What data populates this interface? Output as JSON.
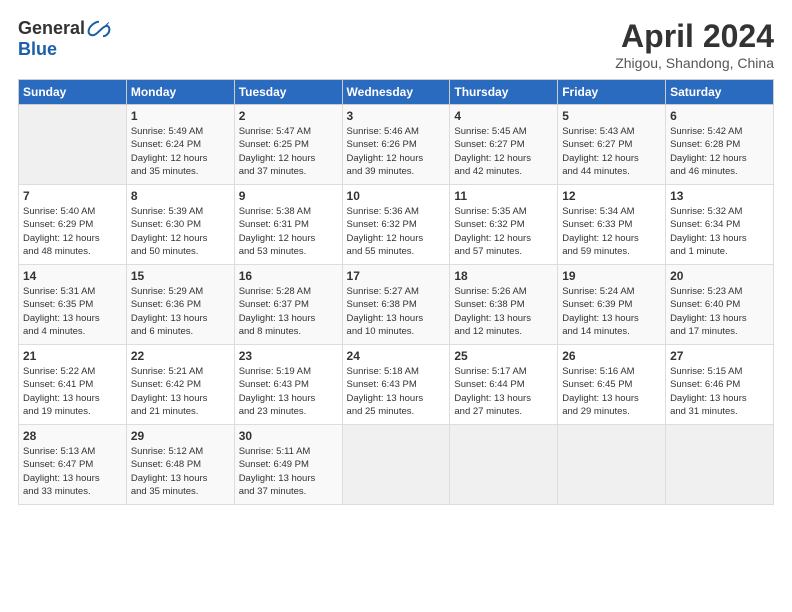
{
  "logo": {
    "general": "General",
    "blue": "Blue"
  },
  "title": "April 2024",
  "subtitle": "Zhigou, Shandong, China",
  "days_header": [
    "Sunday",
    "Monday",
    "Tuesday",
    "Wednesday",
    "Thursday",
    "Friday",
    "Saturday"
  ],
  "weeks": [
    [
      {
        "day": "",
        "info": ""
      },
      {
        "day": "1",
        "info": "Sunrise: 5:49 AM\nSunset: 6:24 PM\nDaylight: 12 hours\nand 35 minutes."
      },
      {
        "day": "2",
        "info": "Sunrise: 5:47 AM\nSunset: 6:25 PM\nDaylight: 12 hours\nand 37 minutes."
      },
      {
        "day": "3",
        "info": "Sunrise: 5:46 AM\nSunset: 6:26 PM\nDaylight: 12 hours\nand 39 minutes."
      },
      {
        "day": "4",
        "info": "Sunrise: 5:45 AM\nSunset: 6:27 PM\nDaylight: 12 hours\nand 42 minutes."
      },
      {
        "day": "5",
        "info": "Sunrise: 5:43 AM\nSunset: 6:27 PM\nDaylight: 12 hours\nand 44 minutes."
      },
      {
        "day": "6",
        "info": "Sunrise: 5:42 AM\nSunset: 6:28 PM\nDaylight: 12 hours\nand 46 minutes."
      }
    ],
    [
      {
        "day": "7",
        "info": "Sunrise: 5:40 AM\nSunset: 6:29 PM\nDaylight: 12 hours\nand 48 minutes."
      },
      {
        "day": "8",
        "info": "Sunrise: 5:39 AM\nSunset: 6:30 PM\nDaylight: 12 hours\nand 50 minutes."
      },
      {
        "day": "9",
        "info": "Sunrise: 5:38 AM\nSunset: 6:31 PM\nDaylight: 12 hours\nand 53 minutes."
      },
      {
        "day": "10",
        "info": "Sunrise: 5:36 AM\nSunset: 6:32 PM\nDaylight: 12 hours\nand 55 minutes."
      },
      {
        "day": "11",
        "info": "Sunrise: 5:35 AM\nSunset: 6:32 PM\nDaylight: 12 hours\nand 57 minutes."
      },
      {
        "day": "12",
        "info": "Sunrise: 5:34 AM\nSunset: 6:33 PM\nDaylight: 12 hours\nand 59 minutes."
      },
      {
        "day": "13",
        "info": "Sunrise: 5:32 AM\nSunset: 6:34 PM\nDaylight: 13 hours\nand 1 minute."
      }
    ],
    [
      {
        "day": "14",
        "info": "Sunrise: 5:31 AM\nSunset: 6:35 PM\nDaylight: 13 hours\nand 4 minutes."
      },
      {
        "day": "15",
        "info": "Sunrise: 5:29 AM\nSunset: 6:36 PM\nDaylight: 13 hours\nand 6 minutes."
      },
      {
        "day": "16",
        "info": "Sunrise: 5:28 AM\nSunset: 6:37 PM\nDaylight: 13 hours\nand 8 minutes."
      },
      {
        "day": "17",
        "info": "Sunrise: 5:27 AM\nSunset: 6:38 PM\nDaylight: 13 hours\nand 10 minutes."
      },
      {
        "day": "18",
        "info": "Sunrise: 5:26 AM\nSunset: 6:38 PM\nDaylight: 13 hours\nand 12 minutes."
      },
      {
        "day": "19",
        "info": "Sunrise: 5:24 AM\nSunset: 6:39 PM\nDaylight: 13 hours\nand 14 minutes."
      },
      {
        "day": "20",
        "info": "Sunrise: 5:23 AM\nSunset: 6:40 PM\nDaylight: 13 hours\nand 17 minutes."
      }
    ],
    [
      {
        "day": "21",
        "info": "Sunrise: 5:22 AM\nSunset: 6:41 PM\nDaylight: 13 hours\nand 19 minutes."
      },
      {
        "day": "22",
        "info": "Sunrise: 5:21 AM\nSunset: 6:42 PM\nDaylight: 13 hours\nand 21 minutes."
      },
      {
        "day": "23",
        "info": "Sunrise: 5:19 AM\nSunset: 6:43 PM\nDaylight: 13 hours\nand 23 minutes."
      },
      {
        "day": "24",
        "info": "Sunrise: 5:18 AM\nSunset: 6:43 PM\nDaylight: 13 hours\nand 25 minutes."
      },
      {
        "day": "25",
        "info": "Sunrise: 5:17 AM\nSunset: 6:44 PM\nDaylight: 13 hours\nand 27 minutes."
      },
      {
        "day": "26",
        "info": "Sunrise: 5:16 AM\nSunset: 6:45 PM\nDaylight: 13 hours\nand 29 minutes."
      },
      {
        "day": "27",
        "info": "Sunrise: 5:15 AM\nSunset: 6:46 PM\nDaylight: 13 hours\nand 31 minutes."
      }
    ],
    [
      {
        "day": "28",
        "info": "Sunrise: 5:13 AM\nSunset: 6:47 PM\nDaylight: 13 hours\nand 33 minutes."
      },
      {
        "day": "29",
        "info": "Sunrise: 5:12 AM\nSunset: 6:48 PM\nDaylight: 13 hours\nand 35 minutes."
      },
      {
        "day": "30",
        "info": "Sunrise: 5:11 AM\nSunset: 6:49 PM\nDaylight: 13 hours\nand 37 minutes."
      },
      {
        "day": "",
        "info": ""
      },
      {
        "day": "",
        "info": ""
      },
      {
        "day": "",
        "info": ""
      },
      {
        "day": "",
        "info": ""
      }
    ]
  ]
}
